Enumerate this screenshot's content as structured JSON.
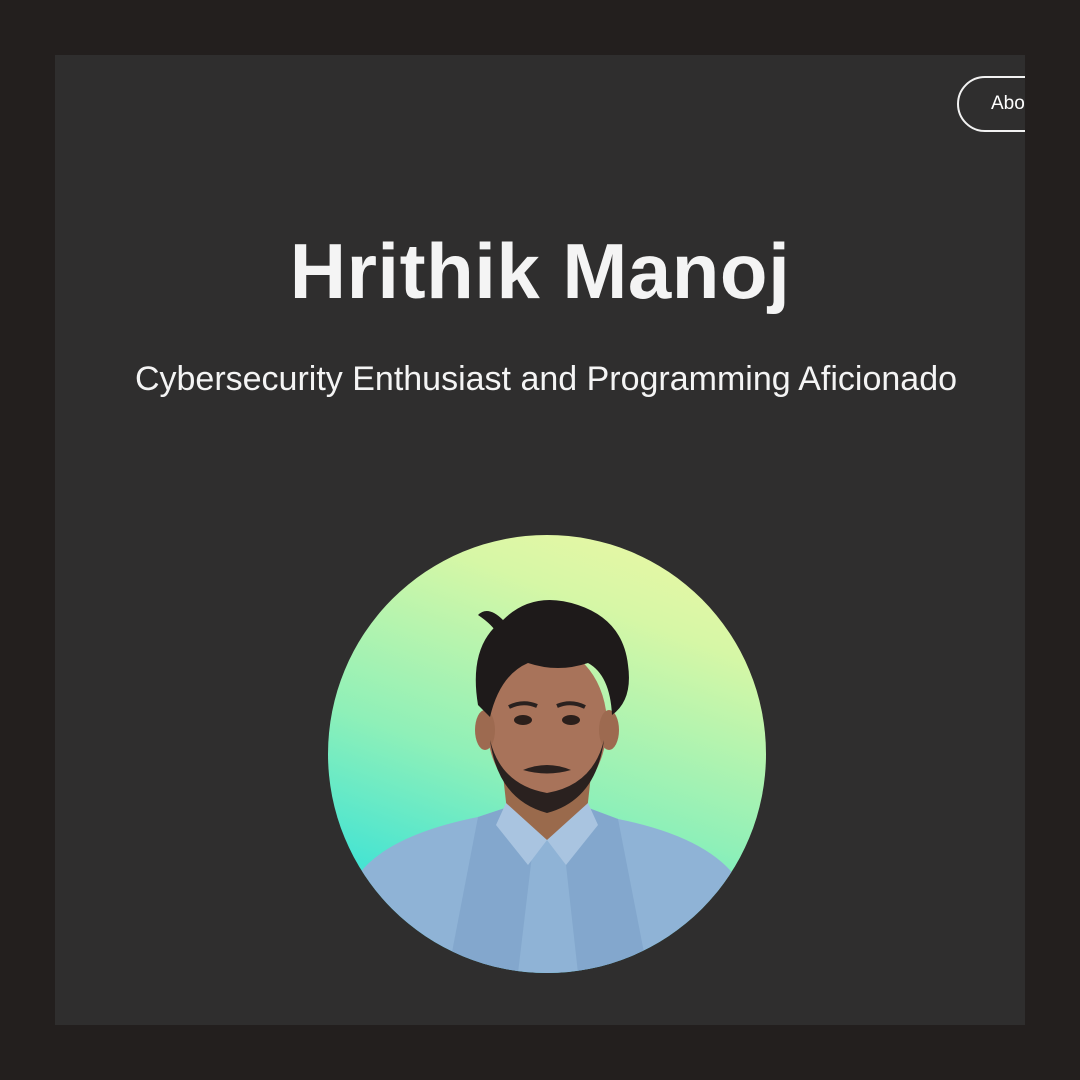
{
  "nav": {
    "about_label": "About"
  },
  "hero": {
    "name": "Hrithik Manoj",
    "tagline": "Cybersecurity Enthusiast and Programming Aficionado"
  },
  "profile": {
    "avatar_alt": "Profile photo",
    "background_colors": [
      "#f0f7a4",
      "#8ff0b8",
      "#37dfd6"
    ]
  }
}
